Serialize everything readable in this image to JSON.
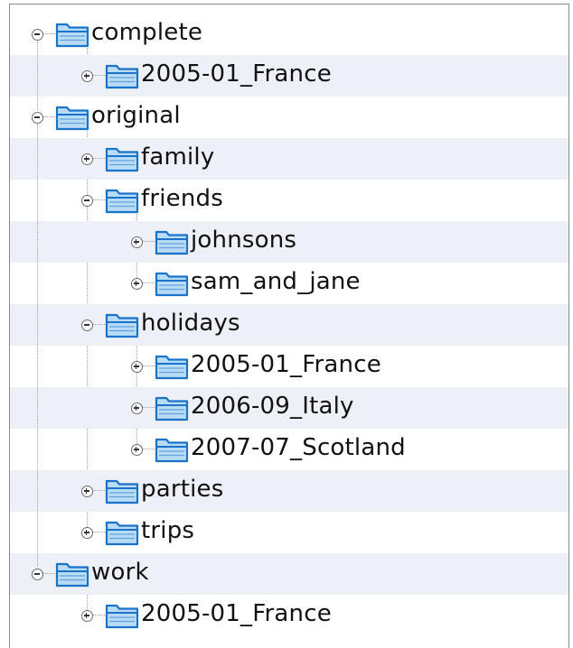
{
  "tree": {
    "nodes": [
      {
        "label": "complete",
        "depth": 0,
        "expanded": true
      },
      {
        "label": "2005-01_France",
        "depth": 1,
        "expanded": false
      },
      {
        "label": "original",
        "depth": 0,
        "expanded": true
      },
      {
        "label": "family",
        "depth": 1,
        "expanded": false
      },
      {
        "label": "friends",
        "depth": 1,
        "expanded": true
      },
      {
        "label": "johnsons",
        "depth": 2,
        "expanded": false
      },
      {
        "label": "sam_and_jane",
        "depth": 2,
        "expanded": false
      },
      {
        "label": "holidays",
        "depth": 1,
        "expanded": true
      },
      {
        "label": "2005-01_France",
        "depth": 2,
        "expanded": false
      },
      {
        "label": "2006-09_Italy",
        "depth": 2,
        "expanded": false
      },
      {
        "label": "2007-07_Scotland",
        "depth": 2,
        "expanded": false
      },
      {
        "label": "parties",
        "depth": 1,
        "expanded": false
      },
      {
        "label": "trips",
        "depth": 1,
        "expanded": false
      },
      {
        "label": "work",
        "depth": 0,
        "expanded": true
      },
      {
        "label": "2005-01_France",
        "depth": 1,
        "expanded": false
      }
    ]
  },
  "icons": {
    "folder": "folder-icon",
    "expanded": "collapse-minus-icon",
    "collapsed": "expand-plus-icon"
  },
  "colors": {
    "folder_fill": "#b9dcf6",
    "folder_stroke": "#1a73c8",
    "row_stripe": "#eef0f8"
  }
}
